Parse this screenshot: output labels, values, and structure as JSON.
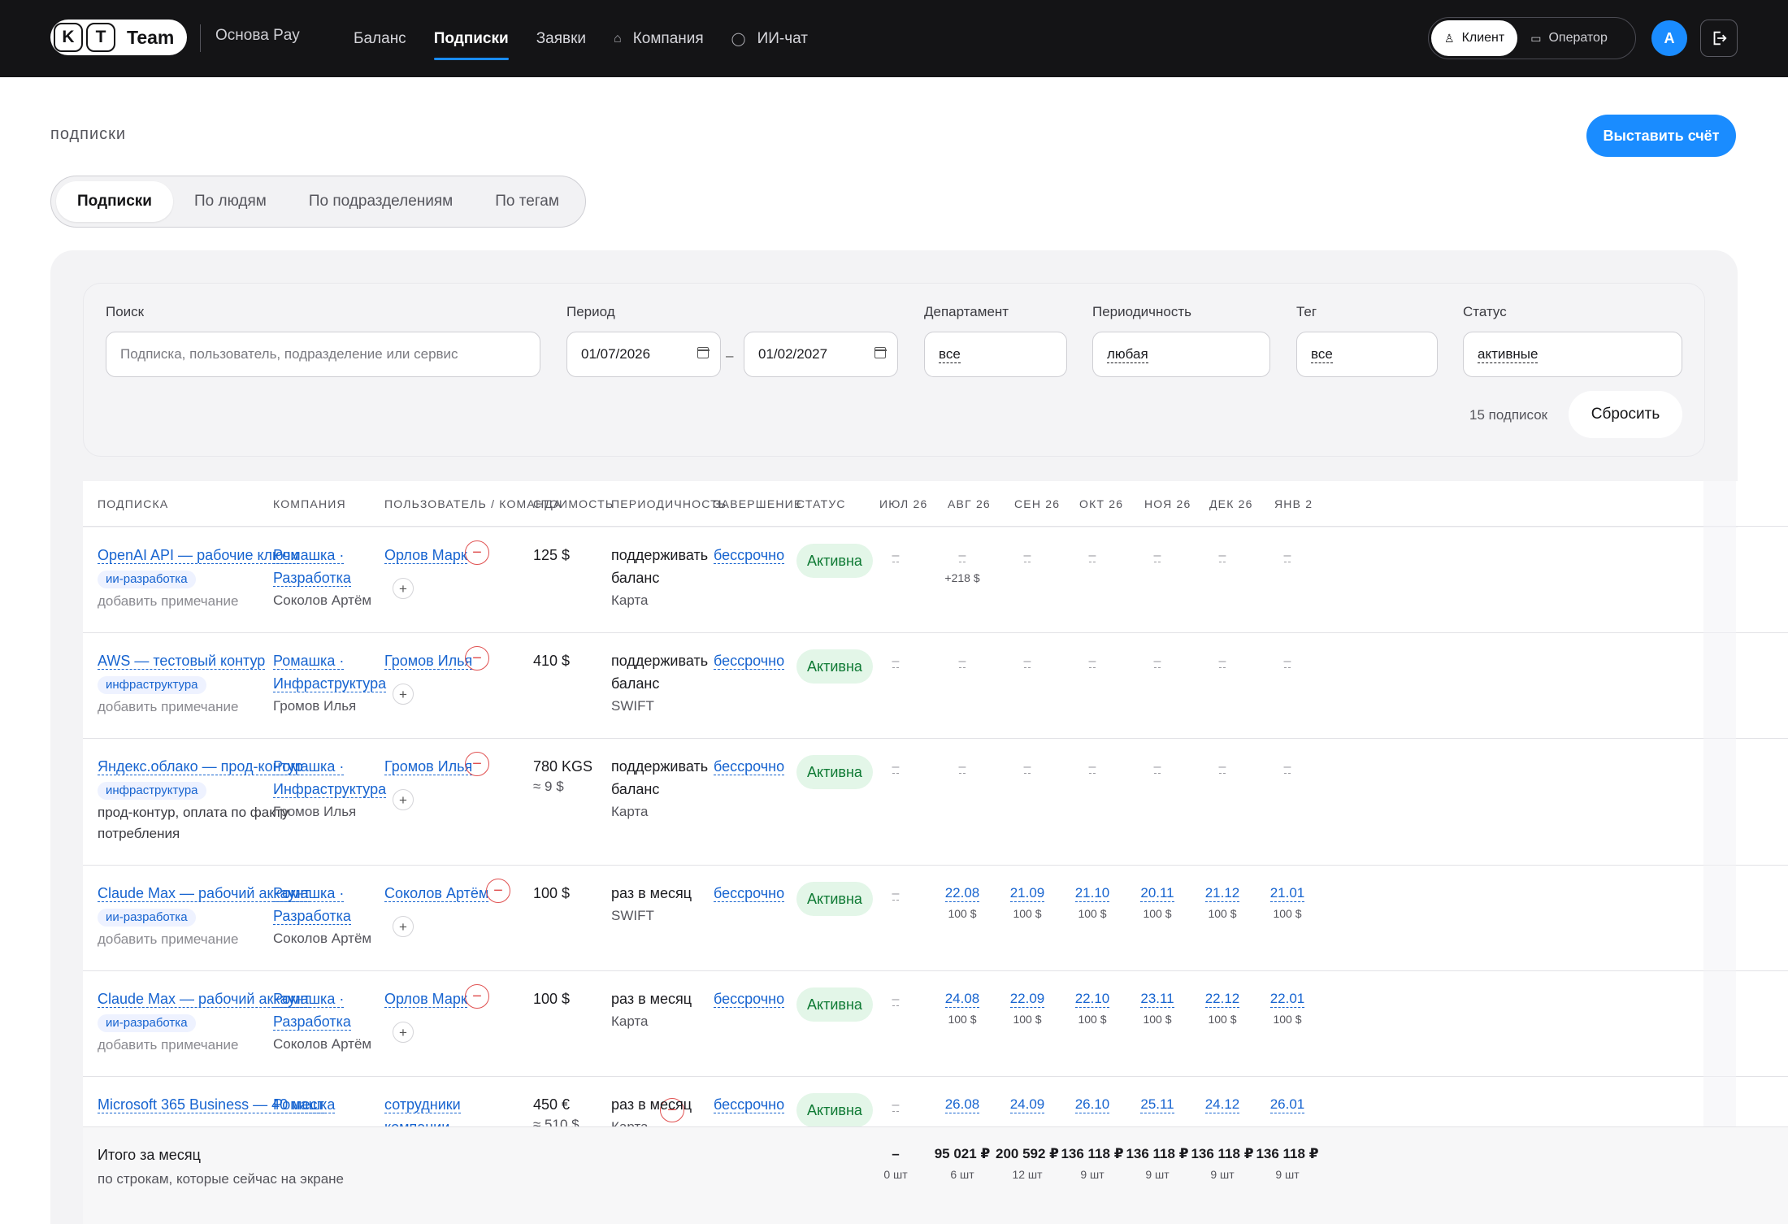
{
  "header": {
    "logo_k": "K",
    "logo_t": "T",
    "logo_team": "Team",
    "brand_sub": "Основа Pay",
    "nav": [
      {
        "label": "Баланс",
        "icon": "",
        "active": false
      },
      {
        "label": "Подписки",
        "icon": "",
        "active": true
      },
      {
        "label": "Заявки",
        "icon": "",
        "active": false
      },
      {
        "label": "Компания",
        "icon": "building-icon",
        "active": false
      },
      {
        "label": "ИИ-чат",
        "icon": "chat-icon",
        "active": false
      }
    ],
    "roles": {
      "client": "Клиент",
      "operator": "Оператор"
    },
    "avatar": "А"
  },
  "page": {
    "title": "подписки",
    "invoice_button": "Выставить счёт"
  },
  "tabs": [
    "Подписки",
    "По людям",
    "По подразделениям",
    "По тегам"
  ],
  "filters": {
    "search": {
      "label": "Поиск",
      "placeholder": "Подписка, пользователь, подразделение или сервис"
    },
    "period": {
      "label": "Период",
      "from": "01/07/2026",
      "to": "01/02/2027"
    },
    "department": {
      "label": "Департамент",
      "value": "все"
    },
    "periodicity": {
      "label": "Периодичность",
      "value": "любая"
    },
    "tag": {
      "label": "Тег",
      "value": "все"
    },
    "status": {
      "label": "Статус",
      "value": "активные"
    },
    "count": "15 подписок",
    "reset": "Сбросить"
  },
  "table": {
    "headers": [
      "ПОДПИСКА",
      "КОМПАНИЯ",
      "ПОЛЬЗОВАТЕЛЬ / КОМАНДА",
      "СТОИМОСТЬ",
      "ПЕРИОДИЧНОСТЬ",
      "ЗАВЕРШЕНИЕ",
      "СТАТУС",
      "ИЮЛ 26",
      "АВГ 26",
      "СЕН 26",
      "ОКТ 26",
      "НОЯ 26",
      "ДЕК 26",
      "ЯНВ 2"
    ],
    "rows": [
      {
        "name": "OpenAI API — рабочие ключи",
        "tag": "ии-разработка",
        "note": "добавить примечание",
        "company": [
          "Ромашка ·",
          "Разработка"
        ],
        "company_person": "Соколов Артём",
        "user": "Орлов Марк",
        "cost": "125 $",
        "cost_sub": "",
        "period": [
          "поддерживать",
          "баланс"
        ],
        "method": "Карта",
        "end": "бессрочно",
        "status": "Активна",
        "months": [
          {
            "d": "",
            "a": ""
          },
          {
            "d": "",
            "a": "",
            "extra": "+218 $"
          },
          {
            "d": "",
            "a": ""
          },
          {
            "d": "",
            "a": ""
          },
          {
            "d": "",
            "a": ""
          },
          {
            "d": "",
            "a": ""
          },
          {
            "d": "",
            "a": ""
          }
        ]
      },
      {
        "name": "AWS — тестовый контур",
        "tag": "инфраструктура",
        "note": "добавить примечание",
        "company": [
          "Ромашка ·",
          "Инфраструктура"
        ],
        "company_person": "Громов Илья",
        "user": "Громов Илья",
        "cost": "410 $",
        "cost_sub": "",
        "period": [
          "поддерживать",
          "баланс"
        ],
        "method": "SWIFT",
        "end": "бессрочно",
        "status": "Активна",
        "months": [
          {
            "d": "",
            "a": ""
          },
          {
            "d": "",
            "a": ""
          },
          {
            "d": "",
            "a": ""
          },
          {
            "d": "",
            "a": ""
          },
          {
            "d": "",
            "a": ""
          },
          {
            "d": "",
            "a": ""
          },
          {
            "d": "",
            "a": ""
          }
        ]
      },
      {
        "name": "Яндекс.облако — прод-контур",
        "tag": "инфраструктура",
        "note": "прод-контур, оплата по факту потребления",
        "company": [
          "Ромашка ·",
          "Инфраструктура"
        ],
        "company_person": "Громов Илья",
        "user": "Громов Илья",
        "cost": "780 KGS",
        "cost_sub": "≈ 9 $",
        "period": [
          "поддерживать",
          "баланс"
        ],
        "method": "Карта",
        "end": "бессрочно",
        "status": "Активна",
        "months": [
          {
            "d": "",
            "a": ""
          },
          {
            "d": "",
            "a": ""
          },
          {
            "d": "",
            "a": ""
          },
          {
            "d": "",
            "a": ""
          },
          {
            "d": "",
            "a": ""
          },
          {
            "d": "",
            "a": ""
          },
          {
            "d": "",
            "a": ""
          }
        ]
      },
      {
        "name": "Claude Max — рабочий аккаунт",
        "tag": "ии-разработка",
        "note": "добавить примечание",
        "company": [
          "Ромашка ·",
          "Разработка"
        ],
        "company_person": "Соколов Артём",
        "user": "Соколов Артём",
        "cost": "100 $",
        "cost_sub": "",
        "period": [
          "раз в месяц"
        ],
        "method": "SWIFT",
        "end": "бессрочно",
        "status": "Активна",
        "months": [
          {
            "d": "",
            "a": ""
          },
          {
            "d": "22.08",
            "a": "100 $"
          },
          {
            "d": "21.09",
            "a": "100 $"
          },
          {
            "d": "21.10",
            "a": "100 $"
          },
          {
            "d": "20.11",
            "a": "100 $"
          },
          {
            "d": "21.12",
            "a": "100 $"
          },
          {
            "d": "21.01",
            "a": "100 $"
          }
        ]
      },
      {
        "name": "Claude Max — рабочий аккаунт",
        "tag": "ии-разработка",
        "note": "добавить примечание",
        "company": [
          "Ромашка ·",
          "Разработка"
        ],
        "company_person": "Соколов Артём",
        "user": "Орлов Марк",
        "cost": "100 $",
        "cost_sub": "",
        "period": [
          "раз в месяц"
        ],
        "method": "Карта",
        "end": "бессрочно",
        "status": "Активна",
        "months": [
          {
            "d": "",
            "a": ""
          },
          {
            "d": "24.08",
            "a": "100 $"
          },
          {
            "d": "22.09",
            "a": "100 $"
          },
          {
            "d": "22.10",
            "a": "100 $"
          },
          {
            "d": "23.11",
            "a": "100 $"
          },
          {
            "d": "22.12",
            "a": "100 $"
          },
          {
            "d": "22.01",
            "a": "100 $"
          }
        ]
      },
      {
        "name": "Microsoft 365 Business — 40 мест",
        "tag": "",
        "note": "",
        "company": [
          "Ромашка"
        ],
        "company_person": "",
        "user": "сотрудники компании",
        "cost": "450 €",
        "cost_sub": "≈ 510 $",
        "period": [
          "раз в месяц"
        ],
        "method": "Карта",
        "end": "бессрочно",
        "status": "Активна",
        "months": [
          {
            "d": "",
            "a": ""
          },
          {
            "d": "26.08",
            "a": ""
          },
          {
            "d": "24.09",
            "a": ""
          },
          {
            "d": "26.10",
            "a": ""
          },
          {
            "d": "25.11",
            "a": ""
          },
          {
            "d": "24.12",
            "a": ""
          },
          {
            "d": "26.01",
            "a": ""
          }
        ]
      }
    ]
  },
  "totals": {
    "label": "Итого за месяц",
    "sublabel": "по строкам, которые сейчас на экране",
    "cols": [
      {
        "v": "–",
        "n": "0 шт"
      },
      {
        "v": "95 021 ₽",
        "n": "6 шт"
      },
      {
        "v": "200 592 ₽",
        "n": "12 шт"
      },
      {
        "v": "136 118 ₽",
        "n": "9 шт"
      },
      {
        "v": "136 118 ₽",
        "n": "9 шт"
      },
      {
        "v": "136 118 ₽",
        "n": "9 шт"
      },
      {
        "v": "136 118 ₽",
        "n": "9 шт"
      }
    ]
  }
}
